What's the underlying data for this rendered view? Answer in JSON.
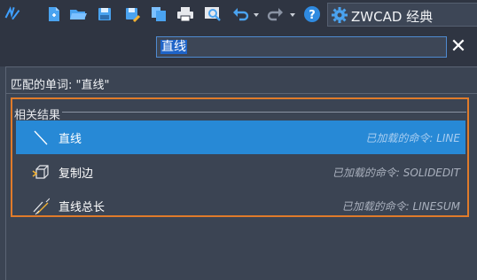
{
  "toolbar": {
    "icons": [
      "app-logo-icon",
      "new-file-icon",
      "open-folder-icon",
      "save-icon",
      "save-as-icon",
      "copy-icon",
      "print-icon",
      "preview-icon",
      "undo-icon",
      "undo-dropdown-icon",
      "redo-icon",
      "redo-dropdown-icon",
      "help-icon"
    ],
    "workspace": {
      "label": "ZWCAD 经典",
      "icon": "gear-icon"
    }
  },
  "search": {
    "value": "直线",
    "close_label": "✕"
  },
  "panel": {
    "match_text": "匹配的单词: \"直线\"",
    "results_title": "相关结果",
    "results": [
      {
        "name": "直线",
        "desc": "已加载的命令: LINE",
        "icon": "line-icon",
        "selected": true
      },
      {
        "name": "复制边",
        "desc": "已加载的命令: SOLIDEDIT",
        "icon": "copy-edge-icon",
        "selected": false
      },
      {
        "name": "直线总长",
        "desc": "已加载的命令: LINESUM",
        "icon": "line-length-icon",
        "selected": false
      }
    ]
  },
  "colors": {
    "accent": "#e07b2a",
    "selection": "#2789d6",
    "background": "#3b4453",
    "toolbar": "#2f3542"
  }
}
